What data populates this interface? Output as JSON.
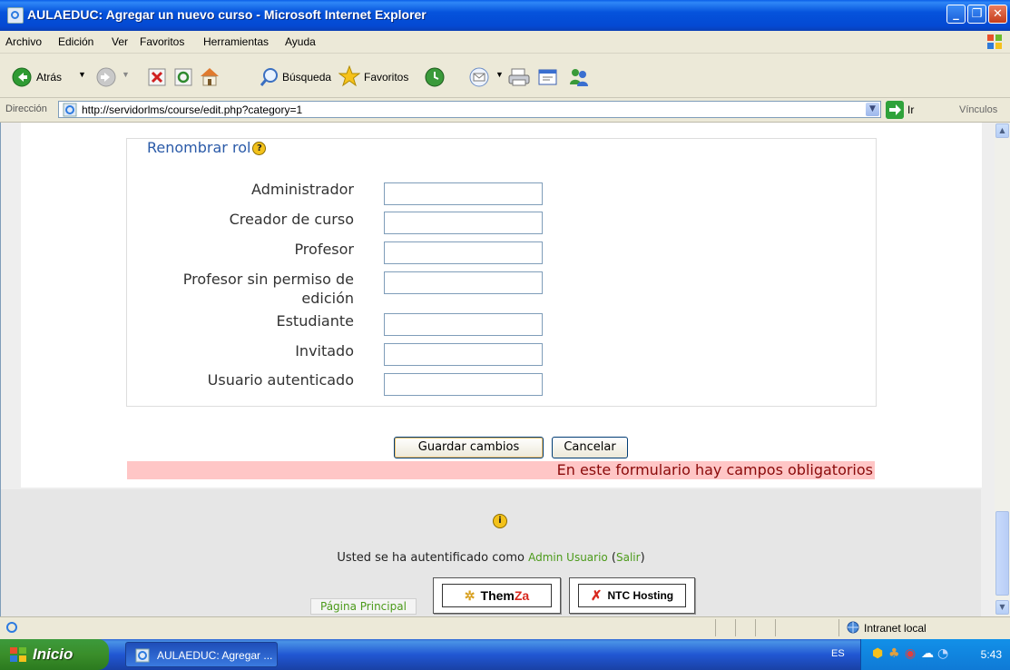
{
  "window": {
    "title": "AULAEDUC: Agregar un nuevo curso - Microsoft Internet Explorer"
  },
  "menu": [
    "Archivo",
    "Edición",
    "Ver",
    "Favoritos",
    "Herramientas",
    "Ayuda"
  ],
  "toolbar": {
    "back": "Atrás",
    "search": "Búsqueda",
    "favorites": "Favoritos"
  },
  "address": {
    "label": "Dirección",
    "url": "http://servidorlms/course/edit.php?category=1",
    "go": "Ir",
    "links": "Vínculos"
  },
  "form": {
    "legend": "Renombrar rol",
    "help_symbol": "?",
    "roles": [
      {
        "label": "Administrador",
        "value": ""
      },
      {
        "label": "Creador de curso",
        "value": ""
      },
      {
        "label": "Profesor",
        "value": ""
      },
      {
        "label": "Profesor sin permiso de edición",
        "value": ""
      },
      {
        "label": "Estudiante",
        "value": ""
      },
      {
        "label": "Invitado",
        "value": ""
      },
      {
        "label": "Usuario autenticado",
        "value": ""
      }
    ],
    "save_label": "Guardar cambios",
    "cancel_label": "Cancelar",
    "required_note": "En este formulario hay campos obligatorios"
  },
  "footer": {
    "info_symbol": "i",
    "login_prefix": "Usted se ha autentificado como",
    "user_name": "Admin Usuario",
    "logout": "Salir",
    "home": "Página Principal",
    "badge1_a": "Them",
    "badge1_b": "Za",
    "badge2": "NTC Hosting"
  },
  "status": {
    "zone": "Intranet local"
  },
  "taskbar": {
    "start": "Inicio",
    "task": "AULAEDUC: Agregar ...",
    "lang": "ES",
    "clock": "5:43"
  },
  "colors": {
    "legend": "#2a5aa8",
    "required_bg": "#ffc6c6",
    "link": "#4b9a1a",
    "titlebar": "#0553dc"
  }
}
